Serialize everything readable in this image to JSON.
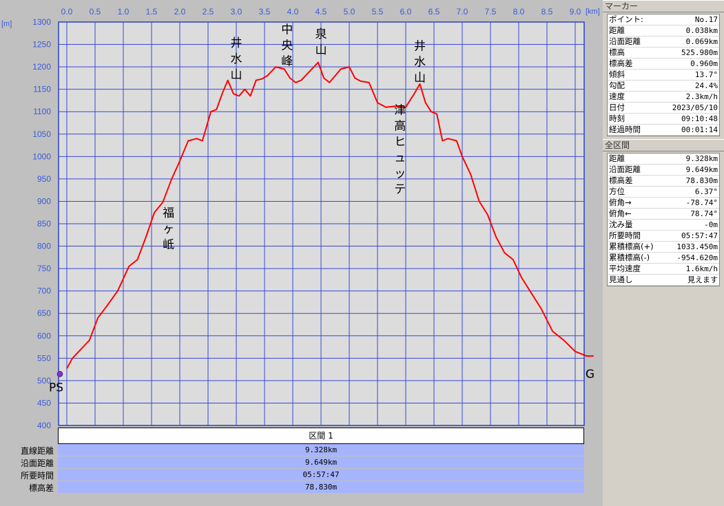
{
  "chart_data": {
    "type": "line",
    "xlabel": "[km]",
    "ylabel": "[m]",
    "xlim": [
      0,
      9.328
    ],
    "ylim": [
      400,
      1300
    ],
    "x_ticks": [
      "0.0",
      "0.5",
      "1.0",
      "1.5",
      "2.0",
      "2.5",
      "3.0",
      "3.5",
      "4.0",
      "4.5",
      "5.0",
      "5.5",
      "6.0",
      "6.5",
      "7.0",
      "7.5",
      "8.0",
      "8.5",
      "9.0"
    ],
    "y_ticks": [
      "400",
      "450",
      "500",
      "550",
      "600",
      "650",
      "700",
      "750",
      "800",
      "850",
      "900",
      "950",
      "1000",
      "1050",
      "1100",
      "1150",
      "1200",
      "1250",
      "1300"
    ],
    "grid": true,
    "series": [
      {
        "color": "#ff0000",
        "x": [
          0,
          0.1,
          0.25,
          0.4,
          0.55,
          0.7,
          0.9,
          1.1,
          1.25,
          1.4,
          1.55,
          1.7,
          1.85,
          2.0,
          2.15,
          2.3,
          2.4,
          2.55,
          2.65,
          2.75,
          2.85,
          2.95,
          3.05,
          3.15,
          3.25,
          3.35,
          3.45,
          3.55,
          3.7,
          3.85,
          3.95,
          4.05,
          4.15,
          4.3,
          4.45,
          4.55,
          4.65,
          4.75,
          4.85,
          5.0,
          5.1,
          5.2,
          5.35,
          5.5,
          5.65,
          5.8,
          6.0,
          6.15,
          6.25,
          6.35,
          6.45,
          6.55,
          6.65,
          6.75,
          6.9,
          7.0,
          7.15,
          7.3,
          7.45,
          7.6,
          7.75,
          7.9,
          8.05,
          8.2,
          8.4,
          8.6,
          8.8,
          9.0,
          9.2,
          9.328
        ],
        "y": [
          527,
          550,
          570,
          590,
          640,
          665,
          700,
          755,
          770,
          820,
          875,
          898,
          948,
          990,
          1035,
          1040,
          1035,
          1100,
          1105,
          1140,
          1170,
          1140,
          1135,
          1150,
          1135,
          1170,
          1173,
          1180,
          1200,
          1195,
          1175,
          1165,
          1170,
          1190,
          1210,
          1175,
          1165,
          1180,
          1195,
          1200,
          1175,
          1168,
          1165,
          1120,
          1110,
          1112,
          1110,
          1140,
          1162,
          1120,
          1100,
          1095,
          1035,
          1040,
          1035,
          1000,
          960,
          900,
          870,
          820,
          785,
          770,
          730,
          700,
          660,
          610,
          590,
          565,
          555,
          555
        ]
      }
    ],
    "annotations": [
      {
        "label": "井\n水\n山",
        "x": 3.0,
        "y_top": 1245
      },
      {
        "label": "中\n央\n峰",
        "x": 3.9,
        "y_top": 1275
      },
      {
        "label": "泉\n山",
        "x": 4.5,
        "y_top": 1265
      },
      {
        "label": "井\n水\n山",
        "x": 6.25,
        "y_top": 1238
      },
      {
        "label": "福\nヶ\n岻",
        "x": 1.8,
        "y_top": 865
      },
      {
        "label": "津\n高\nヒ\nュ\nッ\nテ",
        "x": 5.9,
        "y_top": 1095
      }
    ],
    "endpoint_labels": {
      "start": "PS",
      "goal": "G"
    }
  },
  "section": {
    "title": "区間 1",
    "rows": [
      {
        "label": "直線距離",
        "value": "9.328km"
      },
      {
        "label": "沿面距離",
        "value": "9.649km"
      },
      {
        "label": "所要時間",
        "value": "05:57:47"
      },
      {
        "label": "標高差",
        "value": "78.830m"
      }
    ]
  },
  "marker_panel": {
    "title": "マーカー",
    "rows": [
      {
        "k": "ポイント:",
        "v": "No.17"
      },
      {
        "k": "距離",
        "v": "0.038km"
      },
      {
        "k": "沿面距離",
        "v": "0.069km"
      },
      {
        "k": "標高",
        "v": "525.980m"
      },
      {
        "k": "標高差",
        "v": "0.960m"
      },
      {
        "k": "傾斜",
        "v": "13.7°"
      },
      {
        "k": "勾配",
        "v": "24.4%"
      },
      {
        "k": "速度",
        "v": "2.3km/h"
      },
      {
        "k": "日付",
        "v": "2023/05/10"
      },
      {
        "k": "時刻",
        "v": "09:10:48"
      },
      {
        "k": "経過時間",
        "v": "00:01:14"
      }
    ]
  },
  "total_panel": {
    "title": "全区間",
    "rows": [
      {
        "k": "距離",
        "v": "9.328km"
      },
      {
        "k": "沿面距離",
        "v": "9.649km"
      },
      {
        "k": "標高差",
        "v": "78.830m"
      },
      {
        "k": "方位",
        "v": "6.37°"
      },
      {
        "k": "俯角→",
        "v": "-78.74°"
      },
      {
        "k": "俯角←",
        "v": "78.74°"
      },
      {
        "k": "沈み量",
        "v": "-0m"
      },
      {
        "k": "所要時間",
        "v": "05:57:47"
      },
      {
        "k": "累積標高(+)",
        "v": "1033.450m"
      },
      {
        "k": "累積標高(-)",
        "v": "-954.620m"
      },
      {
        "k": "平均速度",
        "v": "1.6km/h"
      },
      {
        "k": "見通し",
        "v": "見えます"
      }
    ]
  }
}
